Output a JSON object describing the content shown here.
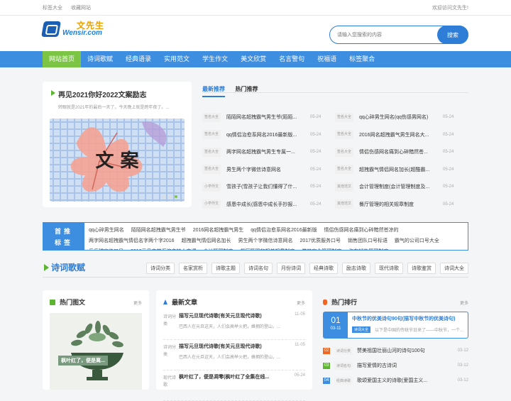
{
  "topbar": {
    "left": [
      "标签大全",
      "收藏网站"
    ],
    "right": "欢迎访问文先生!"
  },
  "logo": {
    "cn": "文先生",
    "en": "Wensir.com"
  },
  "search": {
    "placeholder": "请输入您搜索的内容",
    "button": "搜索"
  },
  "nav": [
    "网站首页",
    "诗词歌赋",
    "经典语录",
    "实用范文",
    "学生作文",
    "美文欣赏",
    "名言警句",
    "祝福语",
    "标签聚合"
  ],
  "feature": {
    "title": "再见2021你好2022文案励志",
    "desc": "转眼就是2021年的最后一天了，今天晚上就是跨年夜了。...",
    "image_text": "文 案"
  },
  "tabs": [
    "最新推荐",
    "热门推荐"
  ],
  "articles": [
    [
      {
        "tag": "签名大全",
        "title": "陌陌网名超拽霸气男生爷(陌陌...",
        "date": "05-24"
      },
      {
        "tag": "签名大全",
        "title": "qq心碎男生网名(qq伤感男网名)",
        "date": "05-24"
      }
    ],
    [
      {
        "tag": "签名大全",
        "title": "qq情侣治愈系网名2016最新版...",
        "date": "05-24"
      },
      {
        "tag": "签名大全",
        "title": "2016网名超拽霸气男生网名大...",
        "date": "05-24"
      }
    ],
    [
      {
        "tag": "签名大全",
        "title": "两字网名超拽霸气男生专属一...",
        "date": "05-24"
      },
      {
        "tag": "签名大全",
        "title": "情侣伤感网名痛到心碎黯然苍...",
        "date": "05-24"
      }
    ],
    [
      {
        "tag": "签名大全",
        "title": "男生两个字微信诗意网名",
        "date": "05-24"
      },
      {
        "tag": "签名大全",
        "title": "超拽霸气情侣网名加长(超酷霸...",
        "date": "05-24"
      }
    ],
    [
      {
        "tag": "小学作文",
        "title": "雪孩子(雪孩子让我们懂得了什...",
        "date": "05-24"
      },
      {
        "tag": "其他范文",
        "title": "会计管理制度(会计管理制度及...",
        "date": "05-24"
      }
    ],
    [
      {
        "tag": "小学作文",
        "title": "感恩中成长(感恩中成长手抄报...",
        "date": "05-24"
      },
      {
        "tag": "其他范文",
        "title": "餐厅管理的相关规章制度",
        "date": "05-24"
      }
    ]
  ],
  "recommend": {
    "label_top": "首推",
    "label_bottom": "标签",
    "links": [
      "qq心碎男生网名",
      "陌陌网名超拽霸气男生爷",
      "2016网名超拽霸气男生",
      "qq情侣治愈系网名2016最新版",
      "情侣伤感网名痛到心碎黯然苍凉的",
      "两字网名超拽霸气情侣名字两个字2016",
      "超拽霸气情侣网名加长",
      "男生两个字微信诗意网名",
      "2017优质服务口号",
      "销售团队口号标语",
      "霸气的公司口号大全",
      "乒乓球宣传口号",
      "2016元旦文艺汇演主持人串词",
      "会计管理制度",
      "餐厅管理的相关规章制度",
      "学校安全管理制度",
      "汽车销售管理制度"
    ]
  },
  "section": {
    "title": "诗词歌赋",
    "tags": [
      "诗词分类",
      "名家赏析",
      "诗歌主题",
      "诗词名句",
      "月份诗词",
      "经典诗歌",
      "励志诗歌",
      "现代诗歌",
      "诗歌鉴赏",
      "诗词大全"
    ]
  },
  "card_photo": {
    "title": "热门图文",
    "more": "更多",
    "caption": "枫叶红了，便是离..."
  },
  "card_news": {
    "title": "最新文章",
    "more": "更多",
    "items": [
      {
        "kind": "诗词分类",
        "title": "描写元旦现代诗歌(有关元旦现代诗歌)",
        "date": "11-05",
        "summary": "巴西人在元旦这天，人们会高举火把，蜂拥的登山，..."
      },
      {
        "kind": "诗词分类",
        "title": "描写元旦现代诗歌(有关元旦现代诗歌)",
        "date": "11-05",
        "summary": "巴西人在元旦这天，人们会高举火把，蜂拥的登山，..."
      },
      {
        "kind": "现代诗歌",
        "title": "枫叶红了，便是凋零(枫叶红了全集在线...",
        "date": "05-24",
        "summary": ""
      }
    ]
  },
  "card_hot": {
    "title": "热门排行",
    "more": "更多",
    "top": {
      "num": "01",
      "date": "03-11",
      "title": "中秋节的优美诗句90句(描写中秋节的优美诗句)",
      "tag": "诗词大全",
      "desc": "以下是中国的传统节日来了——中秋节，一个..."
    },
    "items": [
      {
        "num": "02",
        "color": "#f26522",
        "tag": "诗词分类",
        "title": "赞美祖国壮丽山河的诗句100句",
        "date": "03-12"
      },
      {
        "num": "03",
        "color": "#5cb531",
        "tag": "诗词名句",
        "title": "描写爱情的古诗词",
        "date": "03-12"
      },
      {
        "num": "04",
        "color": "#3d8de0",
        "tag": "经典诗歌",
        "title": "歌颂爱国主义的诗歌(爱国主义...",
        "date": "03-12"
      }
    ]
  },
  "colors": {
    "primary": "#3d8de0",
    "nav_active": "#7cc544",
    "accent_orange": "#e9a100"
  }
}
